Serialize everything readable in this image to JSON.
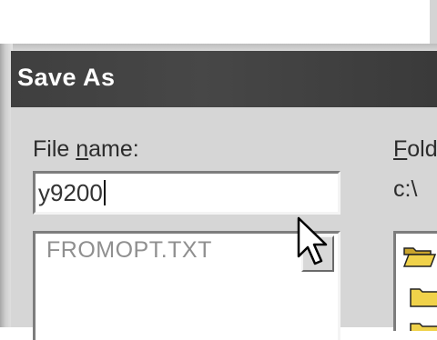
{
  "dialog": {
    "title": "Save As",
    "file_name_label_pre": "File ",
    "file_name_label_underlined": "n",
    "file_name_label_post": "ame:",
    "file_name_value": "y9200",
    "file_list": [
      {
        "name": "FROMOPT.TXT"
      }
    ],
    "folders_label_underlined": "F",
    "folders_label_rest": "old",
    "current_path": "c:\\"
  },
  "icons": {
    "open_folder": "open-folder-icon",
    "folder": "folder-icon",
    "pointer": "mouse-pointer-icon"
  },
  "colors": {
    "title_bar": "#3f3f3f",
    "title_text": "#ffffff",
    "dialog_face": "#d6d6d6",
    "folder_yellow": "#f0d24a"
  }
}
